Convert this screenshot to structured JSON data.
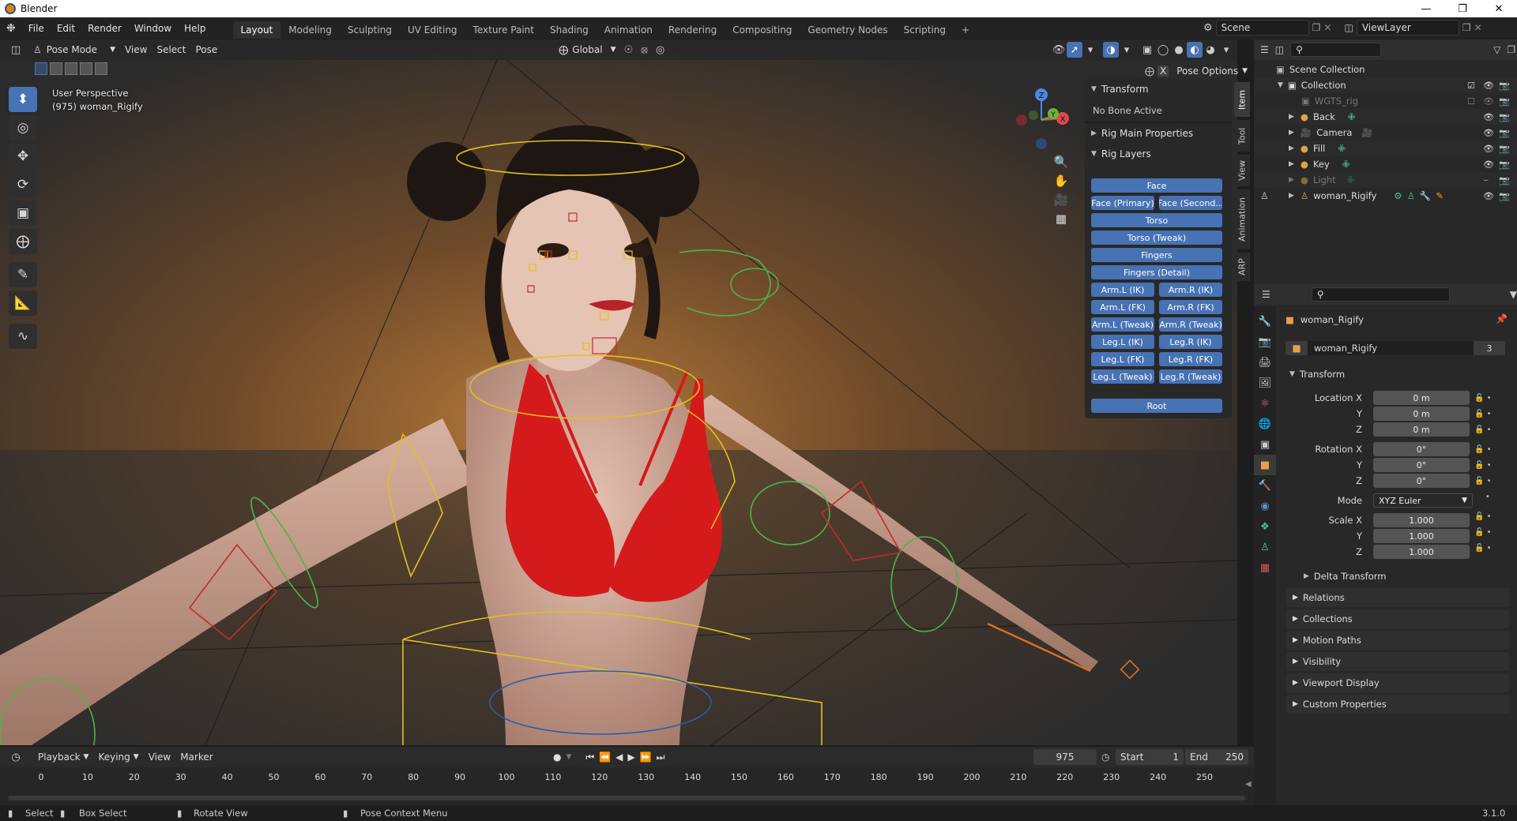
{
  "app": {
    "title": "Blender",
    "version": "3.1.0"
  },
  "menu": [
    "File",
    "Edit",
    "Render",
    "Window",
    "Help"
  ],
  "workspaces": [
    {
      "label": "Layout",
      "active": true
    },
    {
      "label": "Modeling"
    },
    {
      "label": "Sculpting"
    },
    {
      "label": "UV Editing"
    },
    {
      "label": "Texture Paint"
    },
    {
      "label": "Shading"
    },
    {
      "label": "Animation"
    },
    {
      "label": "Rendering"
    },
    {
      "label": "Compositing"
    },
    {
      "label": "Geometry Nodes"
    },
    {
      "label": "Scripting"
    }
  ],
  "add_workspace": "+",
  "scene": "Scene",
  "view_layer": "ViewLayer",
  "viewport": {
    "mode": "Pose Mode",
    "menus": [
      "View",
      "Select",
      "Pose"
    ],
    "orientation": "Global",
    "pose_options": "Pose Options",
    "info_line1": "User Perspective",
    "info_line2": "(975) woman_Rigify",
    "gizmo": {
      "z": "Z",
      "y": "Y",
      "x": "X"
    }
  },
  "npanel": {
    "tabs": [
      "Item",
      "Tool",
      "View",
      "Animation",
      "ARP"
    ],
    "active_tab": "Item",
    "transform_header": "Transform",
    "no_bone": "No Bone Active",
    "rig_main": "Rig Main Properties",
    "rig_layers": "Rig Layers",
    "layers": {
      "face": "Face",
      "face_primary": "Face (Primary)",
      "face_secondary": "Face (Second...",
      "torso": "Torso",
      "torso_tweak": "Torso (Tweak)",
      "fingers": "Fingers",
      "fingers_detail": "Fingers (Detail)",
      "arm_l_ik": "Arm.L (IK)",
      "arm_r_ik": "Arm.R (IK)",
      "arm_l_fk": "Arm.L (FK)",
      "arm_r_fk": "Arm.R (FK)",
      "arm_l_tweak": "Arm.L (Tweak)",
      "arm_r_tweak": "Arm.R (Tweak)",
      "leg_l_ik": "Leg.L (IK)",
      "leg_r_ik": "Leg.R (IK)",
      "leg_l_fk": "Leg.L (FK)",
      "leg_r_fk": "Leg.R (FK)",
      "leg_l_tweak": "Leg.L (Tweak)",
      "leg_r_tweak": "Leg.R (Tweak)",
      "root": "Root"
    }
  },
  "outliner": {
    "scene_collection": "Scene Collection",
    "collection": "Collection",
    "items": [
      {
        "name": "WGTS_rig",
        "dim": true
      },
      {
        "name": "Back"
      },
      {
        "name": "Camera"
      },
      {
        "name": "Fill"
      },
      {
        "name": "Key"
      },
      {
        "name": "Light",
        "dim": true
      },
      {
        "name": "woman_Rigify"
      }
    ]
  },
  "properties": {
    "object_name": "woman_Rigify",
    "data_name": "woman_Rigify",
    "users": "3",
    "transform": "Transform",
    "location_label": "Location X",
    "location": [
      "0 m",
      "0 m",
      "0 m"
    ],
    "rotation_label": "Rotation X",
    "rotation": [
      "0°",
      "0°",
      "0°"
    ],
    "mode_label": "Mode",
    "mode": "XYZ Euler",
    "scale_label": "Scale X",
    "scale": [
      "1.000",
      "1.000",
      "1.000"
    ],
    "y": "Y",
    "z": "Z",
    "delta": "Delta Transform",
    "sections": [
      "Relations",
      "Collections",
      "Motion Paths",
      "Visibility",
      "Viewport Display",
      "Custom Properties"
    ]
  },
  "timeline": {
    "menus": [
      "Playback",
      "Keying",
      "View",
      "Marker"
    ],
    "current_frame": "975",
    "start_label": "Start",
    "start": "1",
    "end_label": "End",
    "end": "250",
    "ticks": [
      "0",
      "10",
      "20",
      "30",
      "40",
      "50",
      "60",
      "70",
      "80",
      "90",
      "100",
      "110",
      "120",
      "130",
      "140",
      "150",
      "160",
      "170",
      "180",
      "190",
      "200",
      "210",
      "220",
      "230",
      "240",
      "250"
    ]
  },
  "statusbar": {
    "select": "Select",
    "box_select": "Box Select",
    "rotate_view": "Rotate View",
    "pose_context": "Pose Context Menu"
  },
  "colors": {
    "accent": "#4772b3",
    "bikini": "#d41a1a",
    "bone_yellow": "#e0c020",
    "bone_green": "#4db34d"
  }
}
